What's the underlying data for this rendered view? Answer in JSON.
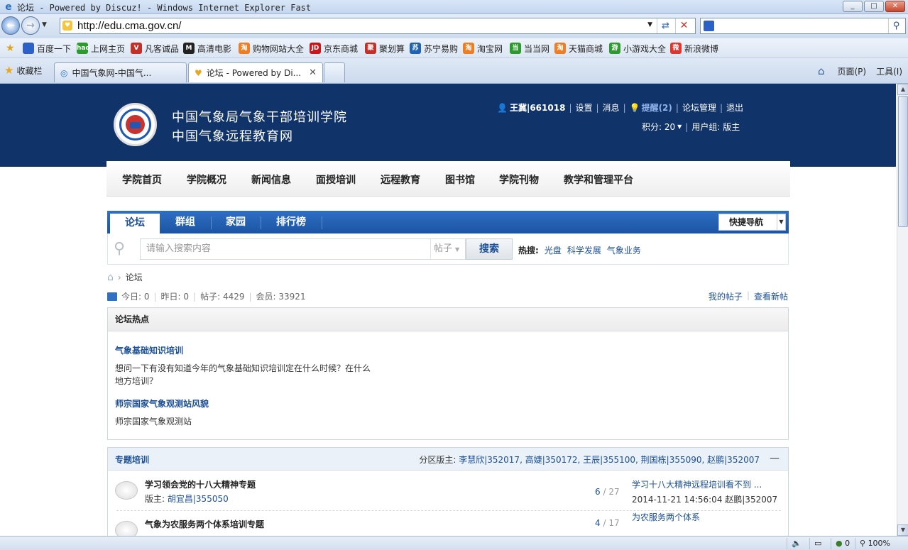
{
  "window": {
    "title": "论坛 - Powered by Discuz! - Windows Internet Explorer Fast",
    "controls": [
      "_",
      "□",
      "✕"
    ]
  },
  "navbar": {
    "url": "http://edu.cma.gov.cn/"
  },
  "favbar": {
    "items": [
      {
        "label": "百度一下",
        "icon": "paw-icon",
        "color": "#2f5fc7",
        "glyph": "🐾"
      },
      {
        "label": "上网主页",
        "icon": "hao-icon",
        "color": "#2d9a2d",
        "glyph": "hao"
      },
      {
        "label": "凡客诚品",
        "icon": "vancl-icon",
        "color": "#c2302a",
        "glyph": "V"
      },
      {
        "label": "高清电影",
        "icon": "movie-icon",
        "color": "#222222",
        "glyph": "M"
      },
      {
        "label": "购物网站大全",
        "icon": "taobao-icon",
        "color": "#f07d22",
        "glyph": "淘"
      },
      {
        "label": "京东商城",
        "icon": "jd-icon",
        "color": "#c8161d",
        "glyph": "JD"
      },
      {
        "label": "聚划算",
        "icon": "juhuasuan-icon",
        "color": "#c2302a",
        "glyph": "聚"
      },
      {
        "label": "苏宁易购",
        "icon": "suning-icon",
        "color": "#1f63b6",
        "glyph": "苏"
      },
      {
        "label": "淘宝网",
        "icon": "taobao-icon",
        "color": "#f07d22",
        "glyph": "淘"
      },
      {
        "label": "当当网",
        "icon": "dangdang-icon",
        "color": "#2d9a2d",
        "glyph": "当"
      },
      {
        "label": "天猫商城",
        "icon": "tmall-icon",
        "color": "#f07d22",
        "glyph": "淘"
      },
      {
        "label": "小游戏大全",
        "icon": "game-icon",
        "color": "#2d9a2d",
        "glyph": "游"
      },
      {
        "label": "新浪微博",
        "icon": "weibo-icon",
        "color": "#e0352d",
        "glyph": "微"
      }
    ]
  },
  "tabbar": {
    "favorites_label": "收藏栏",
    "tabs": [
      {
        "label": "中国气象网-中国气..."
      },
      {
        "label": "论坛 - Powered by Di..."
      }
    ],
    "home_label": "",
    "page_label": "页面(P)",
    "tools_label": "工具(I)"
  },
  "header": {
    "site_name_1": "中国气象局气象干部培训学院",
    "site_name_2": "中国气象远程教育网",
    "username": "王冀|661018",
    "links": [
      "设置",
      "消息"
    ],
    "remind": "提醒(2)",
    "links2": [
      "论坛管理",
      "退出"
    ],
    "credits": "积分: 20",
    "usergroup": "用户组: 版主"
  },
  "mainnav": {
    "items": [
      "学院首页",
      "学院概况",
      "新闻信息",
      "面授培训",
      "远程教育",
      "图书馆",
      "学院刊物",
      "教学和管理平台"
    ]
  },
  "forumtabs": {
    "items": [
      "论坛",
      "群组",
      "家园",
      "排行榜"
    ],
    "quicknav": "快捷导航"
  },
  "search": {
    "placeholder": "请输入搜索内容",
    "type": "帖子",
    "button": "搜索",
    "hot_label": "热搜:",
    "hot_terms": [
      "光盘",
      "科学发展",
      "气象业务"
    ]
  },
  "breadcrumb": {
    "current": "论坛"
  },
  "stats": {
    "today": "今日: 0",
    "yesterday": "昨日: 0",
    "posts": "帖子: 4429",
    "members": "会员: 33921",
    "my_posts": "我的帖子",
    "new_posts": "查看新帖"
  },
  "hotbox": {
    "title": "论坛热点",
    "items": [
      {
        "title": "气象基础知识培训",
        "desc": "想问一下有没有知道今年的气象基础知识培训定在什么时候？在什么地方培训？"
      },
      {
        "title": "师宗国家气象观测站风貌",
        "desc": "师宗国家气象观测站"
      }
    ]
  },
  "category": {
    "name": "专题培训",
    "mods_label": "分区版主:",
    "mods": "李慧欣|352017, 高婕|350172, 王辰|355100, 荆国栋|355090, 赵鹏|352007",
    "forums": [
      {
        "name": "学习领会党的十八大精神专题",
        "mod_label": "版主:",
        "mod": "胡宜昌|355050",
        "threads": "6",
        "posts": "27",
        "last_title": "学习十八大精神远程培训看不到 ...",
        "last_meta": "2014-11-21 14:56:04 赵鹏|352007"
      },
      {
        "name": "气象为农服务两个体系培训专题",
        "mod_label": "",
        "mod": "",
        "threads": "4",
        "posts": "17",
        "last_title": "为农服务两个体系",
        "last_meta": ""
      }
    ]
  },
  "statusbar": {
    "zone": "0",
    "zoom": "100%"
  }
}
